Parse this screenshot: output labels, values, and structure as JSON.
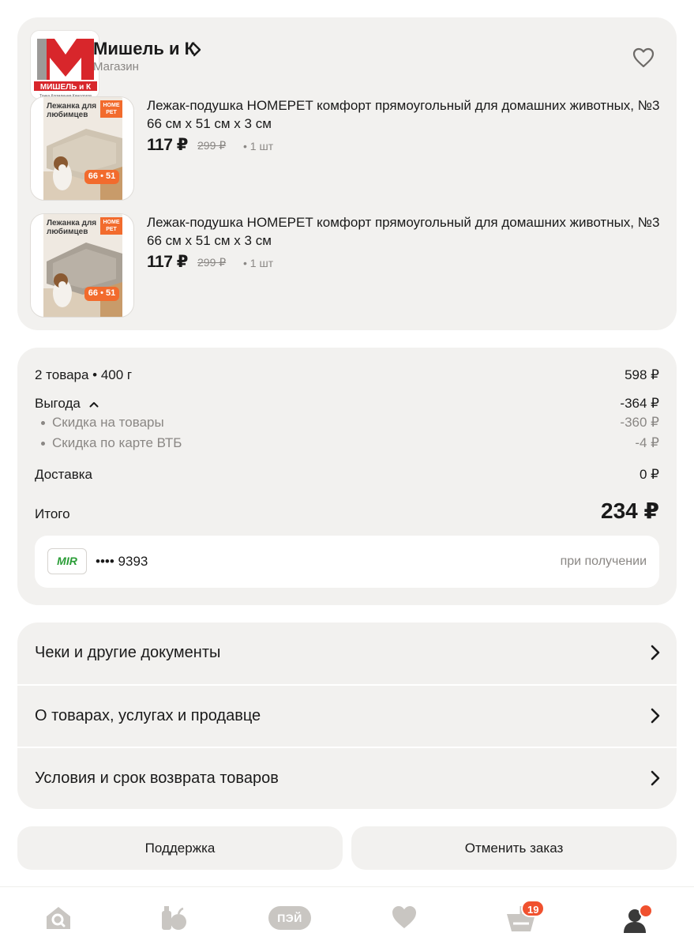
{
  "store": {
    "name": "Мишель и К",
    "subtitle": "Магазин",
    "logo_text": "МИШЕЛЬ и К",
    "logo_sub": "Точка Кормления Кинологов"
  },
  "products": [
    {
      "title": "Лежак-подушка HOMEPET комфорт прямоугольный для домашних животных, №3 66 см х 51 см х 3 см",
      "price": "117 ₽",
      "old_price": "299 ₽",
      "qty": "• 1 шт",
      "thumb_caption": "Лежанка для любимцев",
      "thumb_badge": "HOME PET",
      "thumb_size": "66 • 51"
    },
    {
      "title": "Лежак-подушка HOMEPET комфорт прямоугольный для домашних животных, №3 66 см х 51 см х 3 см",
      "price": "117 ₽",
      "old_price": "299 ₽",
      "qty": "• 1 шт",
      "thumb_caption": "Лежанка для любимцев",
      "thumb_badge": "HOME PET",
      "thumb_size": "66 • 51"
    }
  ],
  "summary": {
    "items_label": "2 товара • 400 г",
    "items_value": "598 ₽",
    "benefit_label": "Выгода",
    "benefit_value": "-364 ₽",
    "discount_items_label": "Скидка на товары",
    "discount_items_value": "-360 ₽",
    "discount_card_label": "Скидка по карте ВТБ",
    "discount_card_value": "-4 ₽",
    "delivery_label": "Доставка",
    "delivery_value": "0 ₽",
    "total_label": "Итого",
    "total_value": "234 ₽"
  },
  "payment": {
    "system": "MIR",
    "card_mask": "•••• 9393",
    "when": "при получении"
  },
  "links": [
    {
      "label": "Чеки и другие документы"
    },
    {
      "label": "О товарах, услугах и продавце"
    },
    {
      "label": "Условия и срок возврата товаров"
    }
  ],
  "buttons": {
    "support": "Поддержка",
    "cancel": "Отменить заказ"
  },
  "nav": {
    "pay_label": "ПЭЙ",
    "cart_badge": "19"
  },
  "colors": {
    "card_bg": "#f2f1ef",
    "accent": "#f0512f",
    "muted": "#8a8784",
    "mir_green": "#2a9d37"
  }
}
